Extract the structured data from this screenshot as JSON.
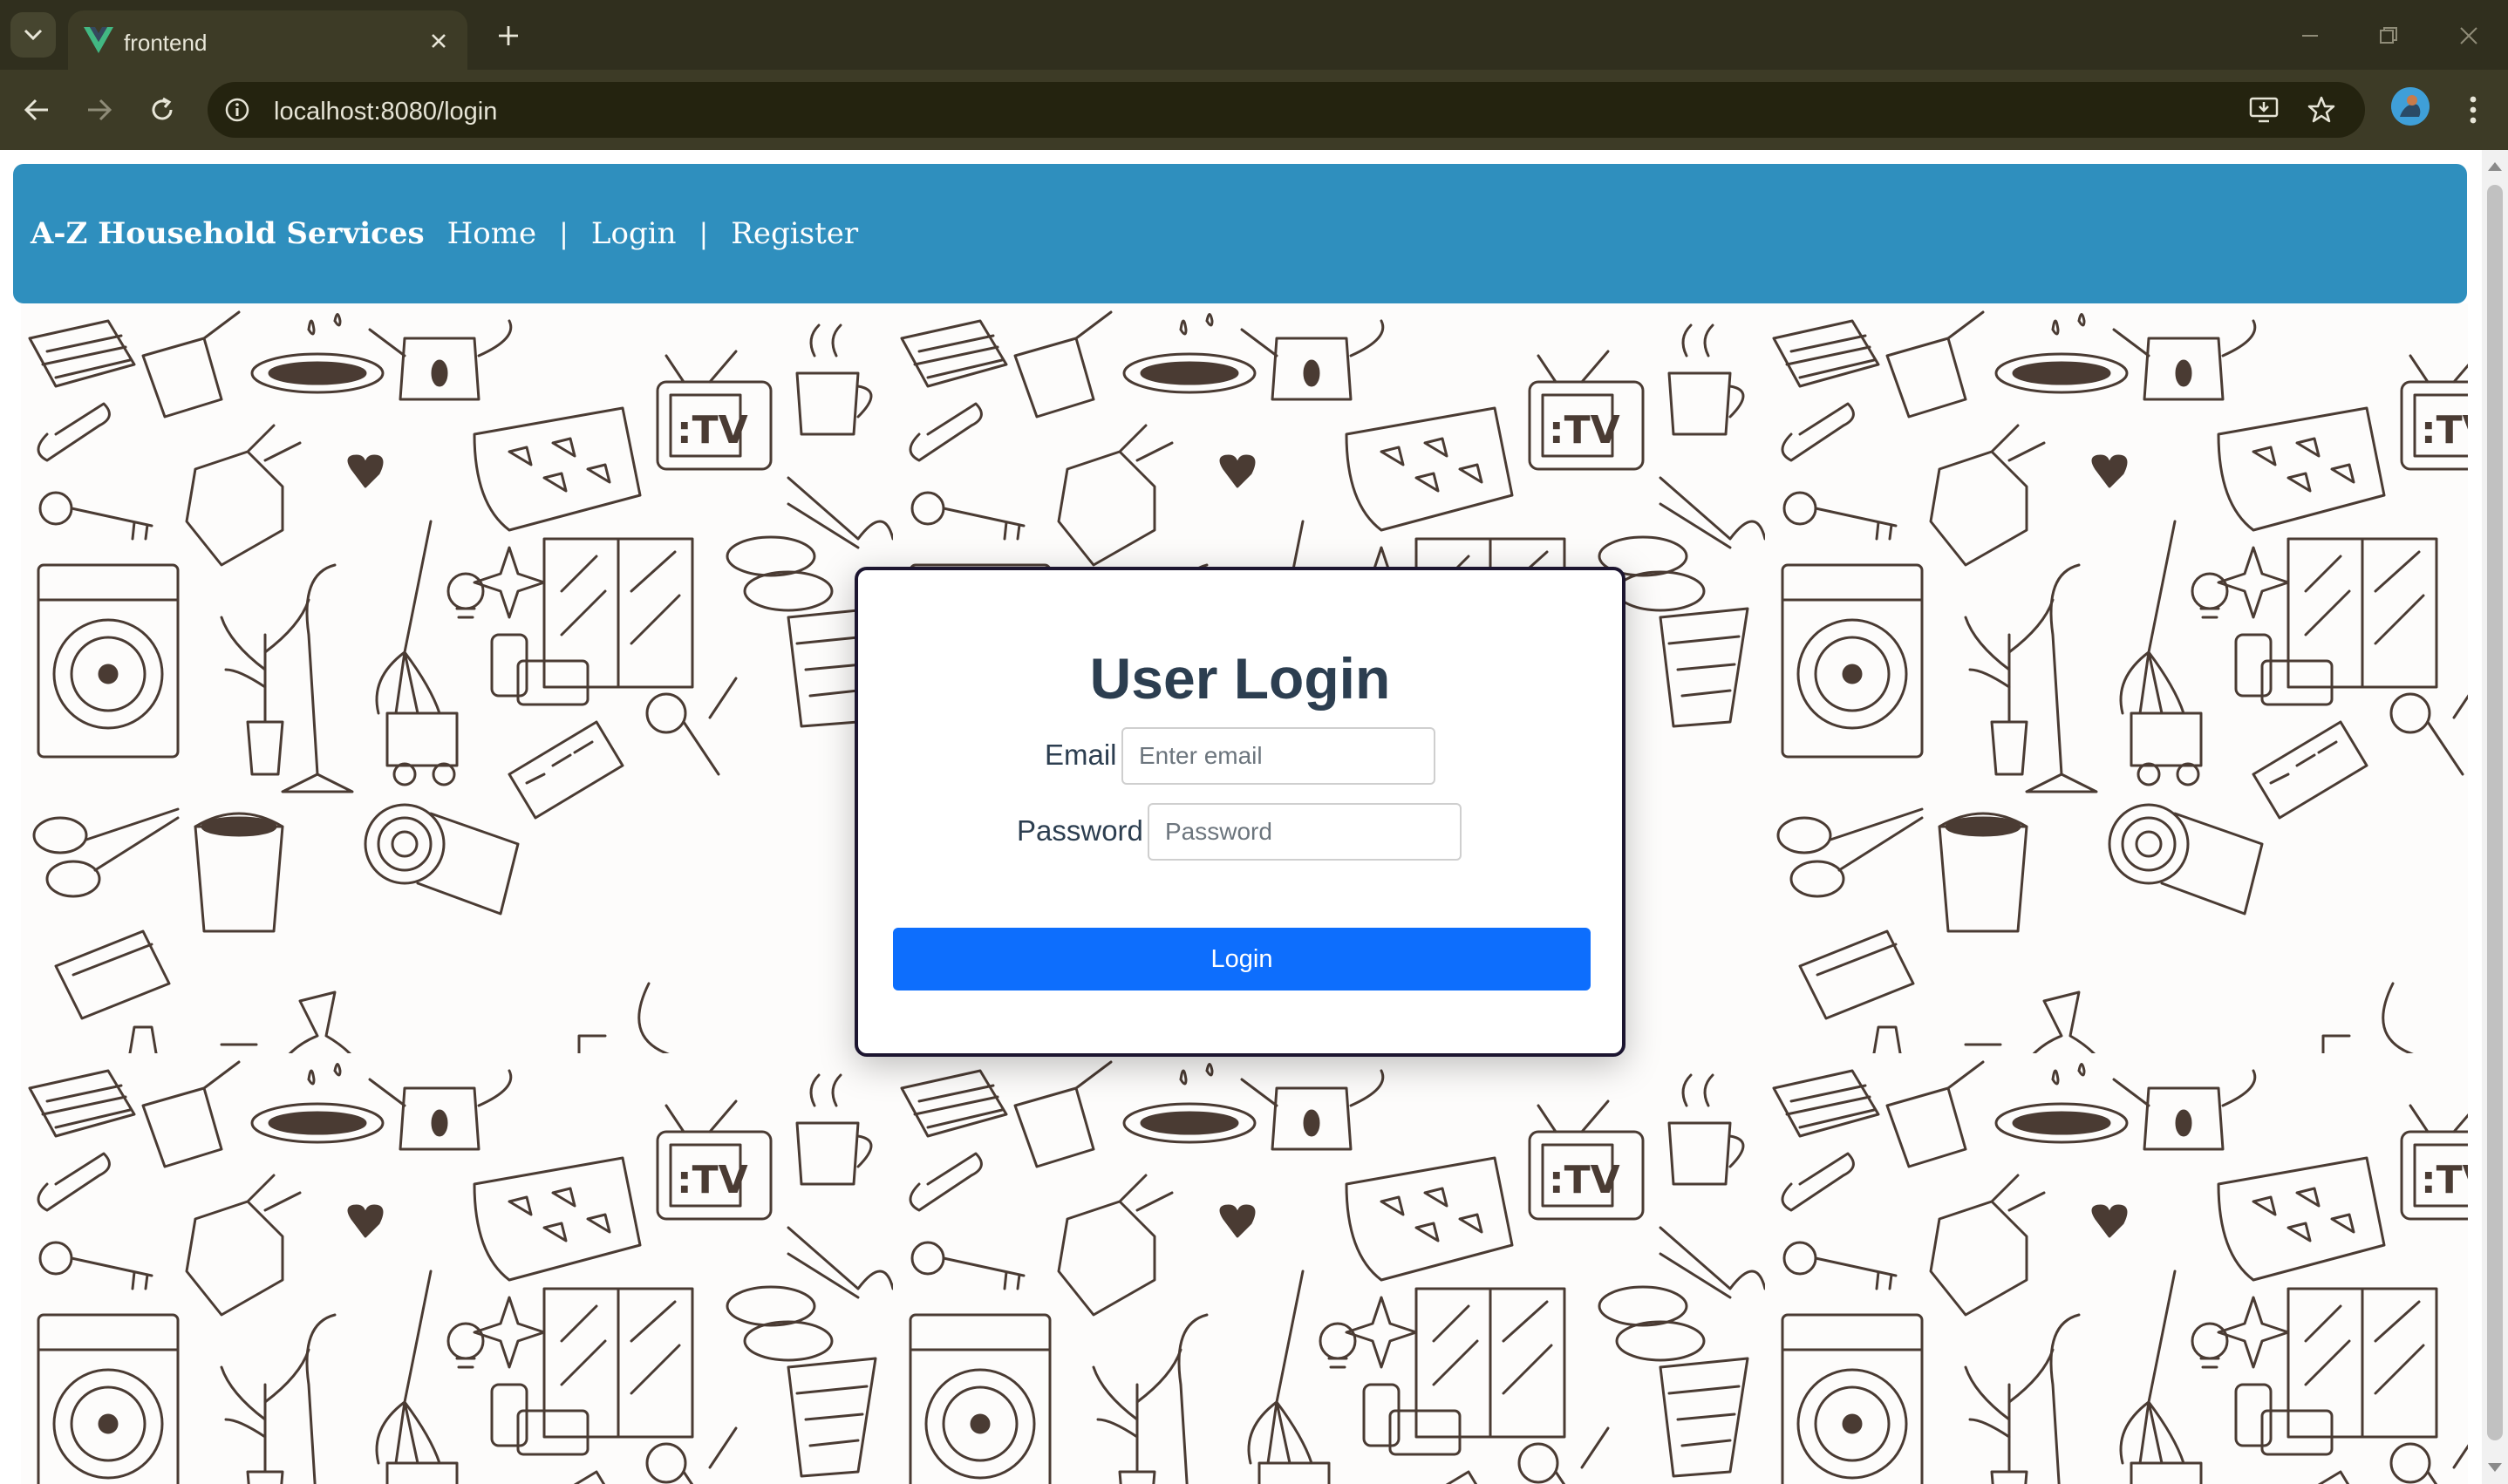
{
  "browser": {
    "tab_title": "frontend",
    "url": "localhost:8080/login",
    "icons": {
      "tab_search": "chevron-down-icon",
      "tab_close": "close-icon",
      "new_tab": "plus-icon",
      "back": "arrow-left-icon",
      "forward": "arrow-right-icon",
      "reload": "reload-icon",
      "site_info": "info-icon",
      "install": "install-app-icon",
      "bookmark": "star-icon",
      "menu": "kebab-menu-icon"
    }
  },
  "navbar": {
    "brand": "A-Z Household Services",
    "links": [
      "Home",
      "Login",
      "Register"
    ],
    "separator": "|",
    "background": "#2f8fbe"
  },
  "login": {
    "title": "User Login",
    "email_label": "Email",
    "email_placeholder": "Enter email",
    "password_label": "Password",
    "password_placeholder": "Password",
    "submit_label": "Login",
    "button_color": "#0d6efd"
  },
  "colors": {
    "chrome_dark": "#302f1e",
    "chrome_toolbar": "#3d3b26",
    "title_text": "#2c3e50",
    "doodle_stroke": "#4a3b33"
  }
}
